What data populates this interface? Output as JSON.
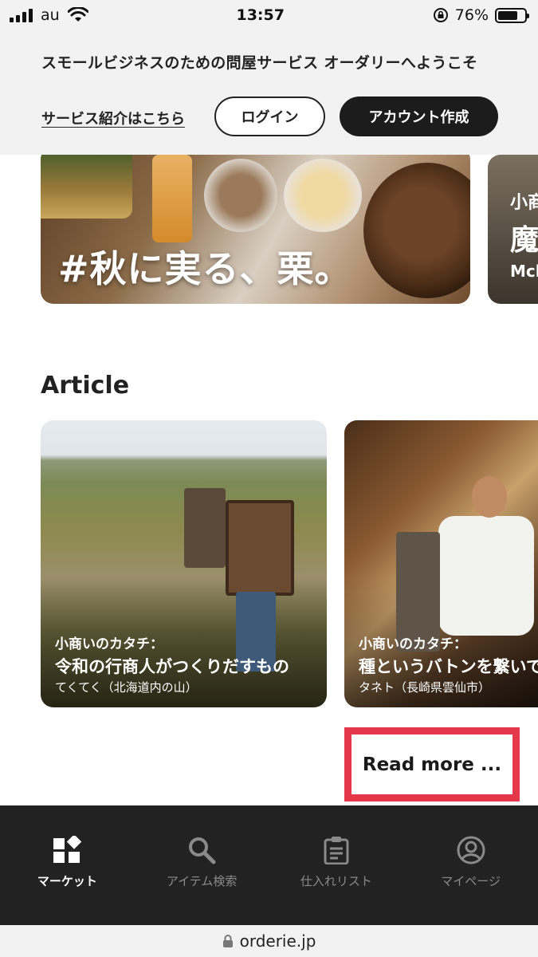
{
  "status_bar": {
    "carrier": "au",
    "time": "13:57",
    "battery_percent": "76%",
    "battery_level": 0.76
  },
  "welcome": {
    "message": "スモールビジネスのための問屋サービス オーダリーへようこそ",
    "service_link": "サービス紹介はこちら",
    "login_label": "ログイン",
    "signup_label": "アカウント作成"
  },
  "features": [
    {
      "title": "#秋に実る、栗。"
    },
    {
      "line1": "小商",
      "line2": "魔",
      "line3": "Mcl"
    }
  ],
  "articles": {
    "section_title": "Article",
    "items": [
      {
        "subtitle": "小商いのカタチ：",
        "title": "令和の行商人がつくりだすもの",
        "meta": "てくてく（北海道内の山）"
      },
      {
        "subtitle": "小商いのカタチ：",
        "title": "種というバトンを繋いで",
        "meta": "タネト（長崎県雲仙市）"
      }
    ],
    "read_more": "Read more ..."
  },
  "bottom_nav": {
    "items": [
      {
        "label": "マーケット",
        "icon": "market-icon",
        "active": true
      },
      {
        "label": "アイテム検索",
        "icon": "search-icon",
        "active": false
      },
      {
        "label": "仕入れリスト",
        "icon": "clipboard-icon",
        "active": false
      },
      {
        "label": "マイページ",
        "icon": "user-icon",
        "active": false
      }
    ]
  },
  "url_bar": {
    "url": "orderie.jp"
  }
}
